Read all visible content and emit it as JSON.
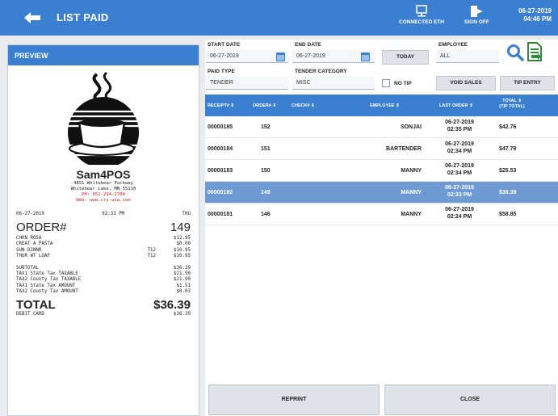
{
  "header": {
    "title": "LIST PAID",
    "connected_label": "CONNECTED ETH",
    "signoff_label": "SIGN OFF",
    "date": "06-27-2019",
    "time": "04:46 PM"
  },
  "preview": {
    "label": "PREVIEW",
    "receipt": {
      "store_name": "Sam4POS",
      "addr1": "4851 Whitebear Parkway",
      "addr2": "Whitebear Lake, MN 55110",
      "phone": "PH: 651-294-2700",
      "web": "Web: www.crs-usa.com",
      "date": "06-27-2019",
      "time": "02:33 PM",
      "day": "THU",
      "order_label": "ORDER#",
      "order_no": "149",
      "items": [
        {
          "name": "CHKN ROSA",
          "mid": "",
          "amount": "$12.95"
        },
        {
          "name": "CREAT A PASTA",
          "mid": "",
          "amount": "$0.00"
        },
        {
          "name": "SUN DINNR",
          "mid": "T12",
          "amount": "$10.95"
        },
        {
          "name": "THUR WT LOAF",
          "mid": "T12",
          "amount": "$10.95"
        }
      ],
      "totals": [
        {
          "name": "SUBTOTAL",
          "amount": "$36.39"
        },
        {
          "name": "TAX1 State Tax TAXABLE",
          "amount": "$21.90"
        },
        {
          "name": "TAX2 County Tax TAXABLE",
          "amount": "$21.90"
        },
        {
          "name": "TAX1 State Tax AMOUNT",
          "amount": "$1.51"
        },
        {
          "name": "TAX2 County Tax AMOUNT",
          "amount": "$0.03"
        }
      ],
      "total_label": "TOTAL",
      "total_amount": "$36.39",
      "payment": "DEBIT CARD",
      "payment_amount": "$36.39"
    }
  },
  "filters": {
    "start_date_label": "START DATE",
    "start_date": "06-27-2019",
    "end_date_label": "END DATE",
    "end_date": "06-27-2019",
    "today_label": "TODAY",
    "employee_label": "EMPLOYEE",
    "employee": "ALL",
    "paid_type_label": "PAID TYPE",
    "paid_type": "TENDER",
    "tender_category_label": "TENDER CATEGORY",
    "tender_category": "MISC",
    "no_tip_label": "NO TIP",
    "void_sales_label": "VOID SALES",
    "tip_entry_label": "TIP ENTRY"
  },
  "table": {
    "headers": {
      "receipt": "RECEIPT# ⇕",
      "order": "ORDER# ⇕",
      "check": "CHECK# ⇕",
      "employee": "EMPLOYEE ⇕",
      "last_order": "LAST ORDER ⇕",
      "total1": "TOTAL ⇕",
      "total2": "(TIP TOTAL)"
    },
    "rows": [
      {
        "receipt": "00000185",
        "order": "152",
        "employee": "SONJAI",
        "date": "06-27-2019",
        "time": "02:35 PM",
        "total": "$42.76"
      },
      {
        "receipt": "00000184",
        "order": "151",
        "employee": "BARTENDER",
        "date": "06-27-2019",
        "time": "02:34 PM",
        "total": "$47.78"
      },
      {
        "receipt": "00000183",
        "order": "150",
        "employee": "MANNY",
        "date": "06-27-2019",
        "time": "02:34 PM",
        "total": "$25.53"
      },
      {
        "receipt": "00000182",
        "order": "149",
        "employee": "MANNY",
        "date": "06-27-2019",
        "time": "02:33 PM",
        "total": "$36.39"
      },
      {
        "receipt": "00000181",
        "order": "146",
        "employee": "MANNY",
        "date": "06-27-2019",
        "time": "02:24 PM",
        "total": "$58.85"
      }
    ],
    "selected_row": 3
  },
  "actions": {
    "reprint_label": "REPRINT",
    "close_label": "CLOSE"
  },
  "colors": {
    "accent": "#3b7fd0",
    "selected_row": "#6e9bd4"
  }
}
